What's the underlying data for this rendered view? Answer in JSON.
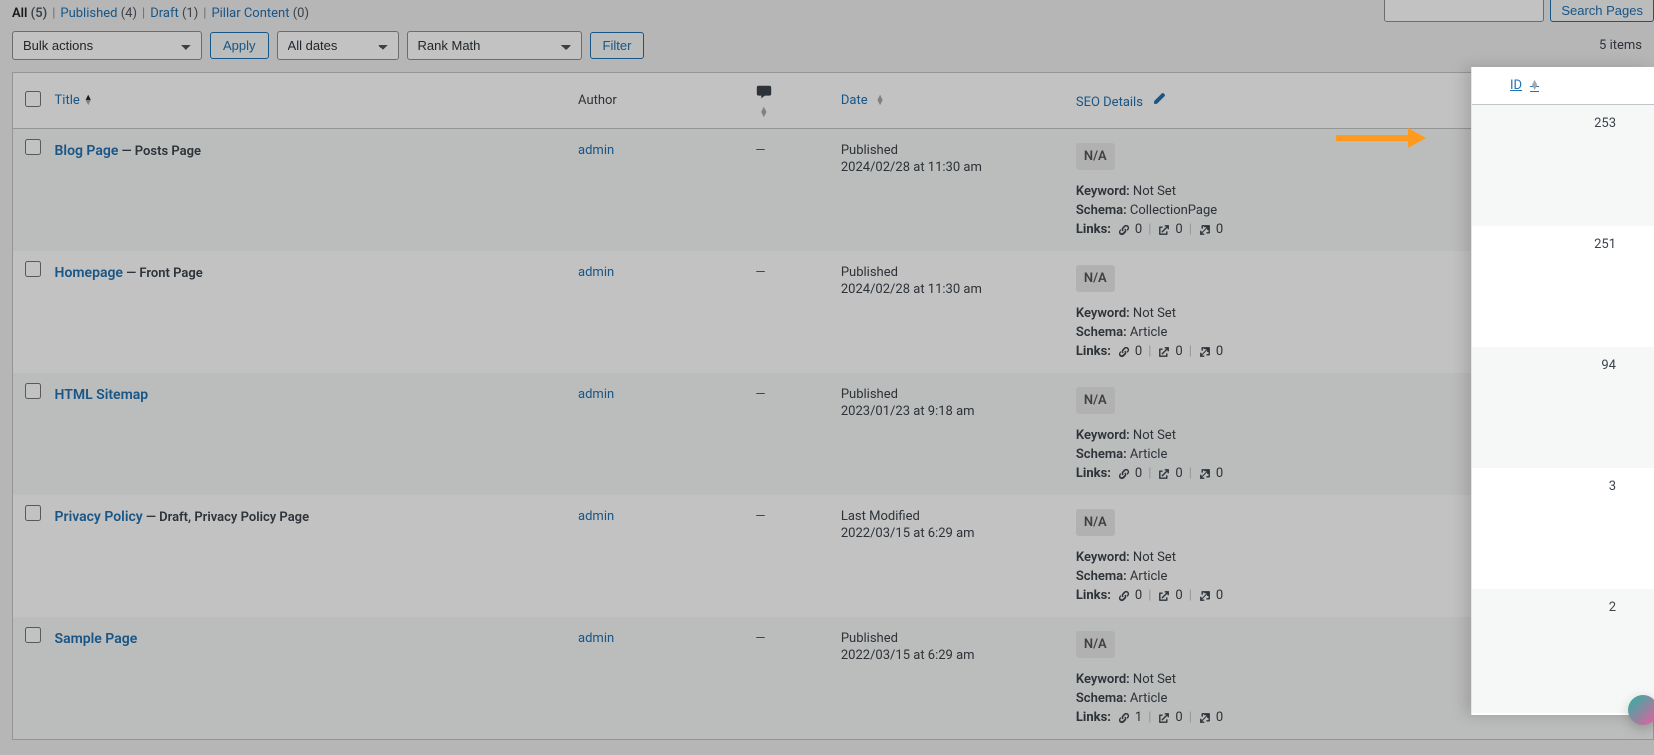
{
  "filters": {
    "all": {
      "label": "All",
      "count": "(5)"
    },
    "published": {
      "label": "Published",
      "count": "(4)"
    },
    "draft": {
      "label": "Draft",
      "count": "(1)"
    },
    "pillar": {
      "label": "Pillar Content",
      "count": "(0)"
    }
  },
  "search": {
    "placeholder": "",
    "button": "Search Pages"
  },
  "toolbar": {
    "bulk": "Bulk actions",
    "apply": "Apply",
    "dates": "All dates",
    "rankmath": "Rank Math",
    "filter": "Filter",
    "items_count": "5 items"
  },
  "columns": {
    "title": "Title",
    "author": "Author",
    "date": "Date",
    "seo": "SEO Details",
    "id": "ID"
  },
  "seo_labels": {
    "keyword": "Keyword:",
    "schema": "Schema:",
    "links": "Links:",
    "na": "N/A"
  },
  "rows": [
    {
      "title": "Blog Page",
      "state": "— Posts Page",
      "author": "admin",
      "comments": "—",
      "date_status": "Published",
      "date_value": "2024/02/28 at 11:30 am",
      "seo": {
        "keyword": "Not Set",
        "schema": "CollectionPage",
        "links": [
          "0",
          "0",
          "0"
        ]
      },
      "id": "253"
    },
    {
      "title": "Homepage",
      "state": "— Front Page",
      "author": "admin",
      "comments": "—",
      "date_status": "Published",
      "date_value": "2024/02/28 at 11:30 am",
      "seo": {
        "keyword": "Not Set",
        "schema": "Article",
        "links": [
          "0",
          "0",
          "0"
        ]
      },
      "id": "251"
    },
    {
      "title": "HTML Sitemap",
      "state": "",
      "author": "admin",
      "comments": "—",
      "date_status": "Published",
      "date_value": "2023/01/23 at 9:18 am",
      "seo": {
        "keyword": "Not Set",
        "schema": "Article",
        "links": [
          "0",
          "0",
          "0"
        ]
      },
      "id": "94"
    },
    {
      "title": "Privacy Policy",
      "state": "— Draft, Privacy Policy Page",
      "author": "admin",
      "comments": "—",
      "date_status": "Last Modified",
      "date_value": "2022/03/15 at 6:29 am",
      "seo": {
        "keyword": "Not Set",
        "schema": "Article",
        "links": [
          "0",
          "0",
          "0"
        ]
      },
      "id": "3"
    },
    {
      "title": "Sample Page",
      "state": "",
      "author": "admin",
      "comments": "—",
      "date_status": "Published",
      "date_value": "2022/03/15 at 6:29 am",
      "seo": {
        "keyword": "Not Set",
        "schema": "Article",
        "links": [
          "1",
          "0",
          "0"
        ]
      },
      "id": "2"
    }
  ]
}
